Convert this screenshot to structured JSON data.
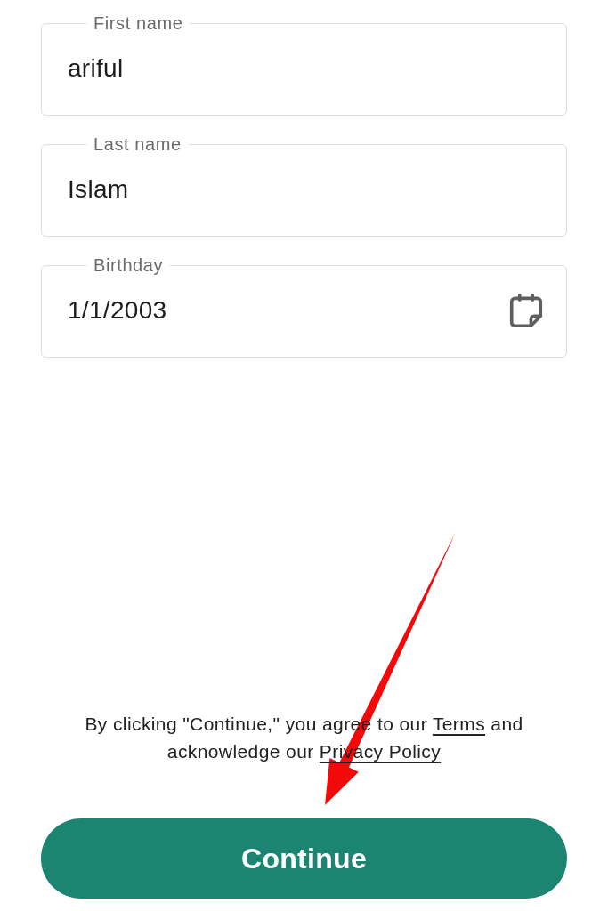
{
  "fields": [
    {
      "kind": "text",
      "label": "First name",
      "value": "ariful"
    },
    {
      "kind": "text",
      "label": "Last name",
      "value": "Islam"
    },
    {
      "kind": "date",
      "label": "Birthday",
      "value": "1/1/2003"
    }
  ],
  "consent": {
    "before": "By clicking \"Continue,\" you agree to our",
    "terms_link": "Terms",
    "middle": "and acknowledge our",
    "privacy_link": "Privacy Policy"
  },
  "continue_button": {
    "label": "Continue"
  }
}
